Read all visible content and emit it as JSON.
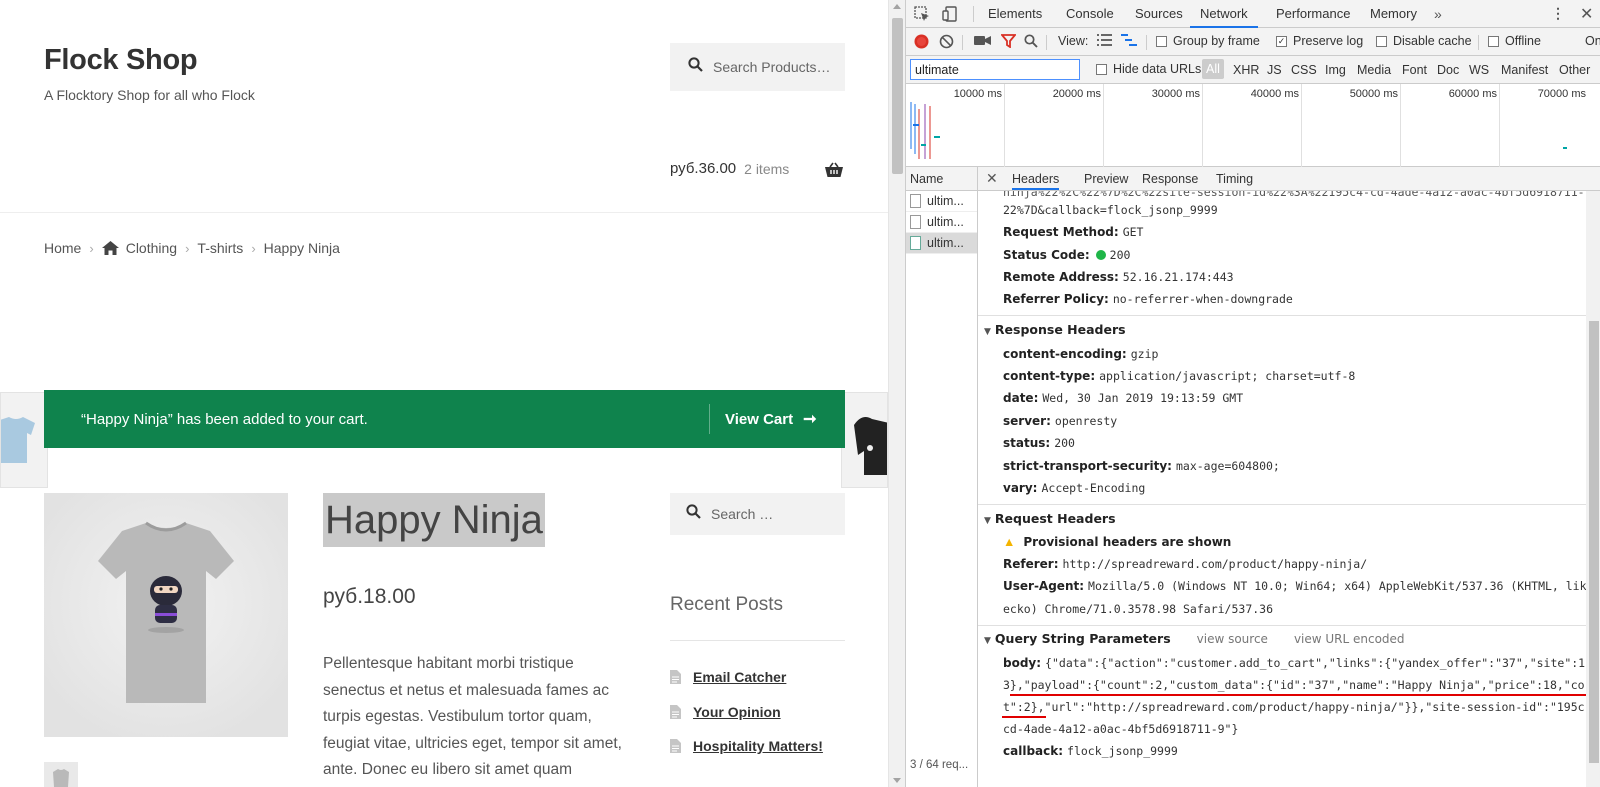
{
  "shop": {
    "site_title": "Flock Shop",
    "site_description": "A Flocktory Shop for all who Flock",
    "search_placeholder": "Search Products…",
    "cart_total": "руб.36.00",
    "cart_items": "2 items",
    "breadcrumb": [
      "Home",
      "Clothing",
      "T-shirts",
      "Happy Ninja"
    ],
    "notice_message": "“Happy Ninja” has been added to your cart.",
    "view_cart_label": "View Cart",
    "product_title": "Happy Ninja",
    "product_price": "руб.18.00",
    "product_description": "Pellentesque habitant morbi tristique senectus et netus et malesuada fames ac turpis egestas. Vestibulum tortor quam, feugiat vitae, ultricies eget, tempor sit amet, ante. Donec eu libero sit amet quam egestas",
    "sidebar_search_placeholder": "Search …",
    "recent_posts_title": "Recent Posts",
    "recent_posts": [
      "Email Catcher",
      "Your Opinion",
      "Hospitality Matters!"
    ],
    "notice_color": "#0f834d"
  },
  "devtools": {
    "tabs": [
      "Elements",
      "Console",
      "Sources",
      "Network",
      "Performance",
      "Memory"
    ],
    "active_tab": "Network",
    "more_tabs": "»",
    "toolbar": {
      "view_label": "View:",
      "group_by_frame": "Group by frame",
      "preserve_log": "Preserve log",
      "disable_cache": "Disable cache",
      "offline": "Offline",
      "online": "On"
    },
    "filter": {
      "value": "ultimate",
      "hide_data_urls": "Hide data URLs",
      "types": [
        "All",
        "XHR",
        "JS",
        "CSS",
        "Img",
        "Media",
        "Font",
        "Doc",
        "WS",
        "Manifest",
        "Other"
      ]
    },
    "timeline_labels": [
      "10000 ms",
      "20000 ms",
      "30000 ms",
      "40000 ms",
      "50000 ms",
      "60000 ms",
      "70000 ms"
    ],
    "requests_header": "Name",
    "requests": [
      "ultim...",
      "ultim...",
      "ultim..."
    ],
    "request_count": "3 / 64 req...",
    "detail_tabs": [
      "Headers",
      "Preview",
      "Response",
      "Timing"
    ],
    "general": {
      "url_fragment_1": "ninja%22%2C%22%7D%2C%22site-session-id%22%3A%22195c4-cd-4ade-4a12-a0ac-4bf5d6918711-",
      "url_fragment_2": "22%7D&callback=flock_jsonp_9999",
      "request_method_key": "Request Method:",
      "request_method": "GET",
      "status_code_key": "Status Code:",
      "status_code": "200",
      "remote_address_key": "Remote Address:",
      "remote_address": "52.16.21.174:443",
      "referrer_policy_key": "Referrer Policy:",
      "referrer_policy": "no-referrer-when-downgrade"
    },
    "response_headers_title": "Response Headers",
    "response_headers": [
      {
        "k": "content-encoding:",
        "v": "gzip"
      },
      {
        "k": "content-type:",
        "v": "application/javascript; charset=utf-8"
      },
      {
        "k": "date:",
        "v": "Wed, 30 Jan 2019 19:13:59 GMT"
      },
      {
        "k": "server:",
        "v": "openresty"
      },
      {
        "k": "status:",
        "v": "200"
      },
      {
        "k": "strict-transport-security:",
        "v": "max-age=604800;"
      },
      {
        "k": "vary:",
        "v": "Accept-Encoding"
      }
    ],
    "request_headers_title": "Request Headers",
    "provisional_warning": "Provisional headers are shown",
    "referer_key": "Referer:",
    "referer": "http://spreadreward.com/product/happy-ninja/",
    "user_agent_key": "User-Agent:",
    "user_agent": "Mozilla/5.0 (Windows NT 10.0; Win64; x64) AppleWebKit/537.36 (KHTML, like",
    "user_agent_2": "ecko) Chrome/71.0.3578.98 Safari/537.36",
    "query_title": "Query String Parameters",
    "view_source": "view source",
    "view_url_encoded": "view URL encoded",
    "body_key": "body:",
    "body_line_1": "{\"data\":{\"action\":\"customer.add_to_cart\",\"links\":{\"yandex_offer\":\"37\",\"site\":1",
    "body_line_2": "3},\"payload\":{\"count\":2,\"custom_data\":{\"id\":\"37\",\"name\":\"Happy Ninja\",\"price\":18,\"co",
    "body_line_3": "t\":2},\"url\":\"http://spreadreward.com/product/happy-ninja/\"}},\"site-session-id\":\"195c",
    "body_line_4": "cd-4ade-4a12-a0ac-4bf5d6918711-9\"}",
    "callback_key": "callback:",
    "callback": "flock_jsonp_9999",
    "accent_color": "#1a73e8",
    "highlight_color": "#e00000"
  }
}
